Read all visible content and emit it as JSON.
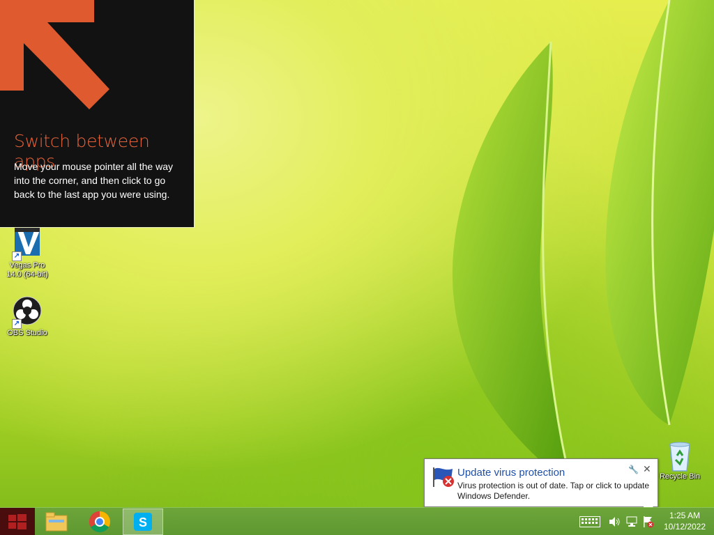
{
  "tip": {
    "title": "Switch between apps",
    "body": "Move your mouse pointer all the way into the corner, and then click to go back to the last app you were using.",
    "accent": "#e05a30"
  },
  "desktop_icons": [
    {
      "label": "Vegas Pro 14.0 (64-bit)",
      "icon": "vegas-pro-icon"
    },
    {
      "label": "OBS Studio",
      "icon": "obs-studio-icon"
    },
    {
      "label": "Recycle Bin",
      "icon": "recycle-bin-icon"
    }
  ],
  "taskbar": {
    "pinned": [
      {
        "icon": "file-explorer-icon",
        "active": false
      },
      {
        "icon": "chrome-icon",
        "active": false
      },
      {
        "icon": "skype-icon",
        "active": true
      }
    ],
    "tray": [
      "keyboard-icon",
      "volume-icon",
      "network-icon",
      "action-center-flag-icon"
    ],
    "time": "1:25 AM",
    "date": "10/12/2022"
  },
  "notification": {
    "title": "Update virus protection",
    "message": "Virus protection is out of date. Tap or click to update Windows Defender.",
    "icon": "defender-warning-flag-icon",
    "title_color": "#1e4fa8"
  }
}
